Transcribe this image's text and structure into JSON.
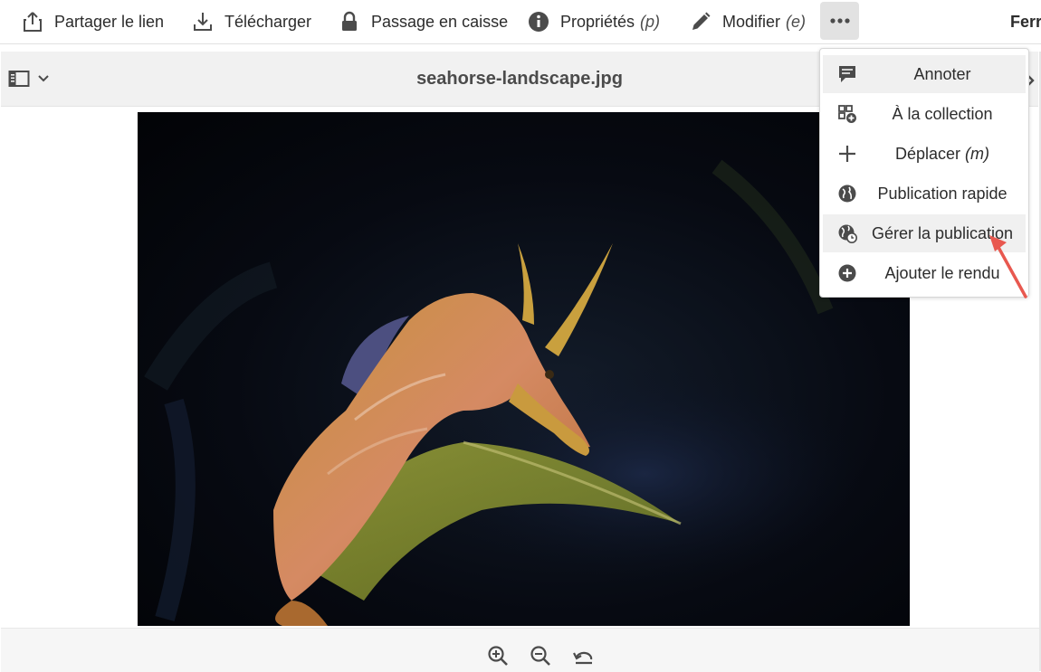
{
  "toolbar": {
    "share_label": "Partager le lien",
    "download_label": "Télécharger",
    "checkout_label": "Passage en caisse",
    "properties_label": "Propriétés",
    "properties_hotkey": "(p)",
    "edit_label": "Modifier",
    "edit_hotkey": "(e)",
    "more_label": "•••",
    "close_label": "Ferr"
  },
  "title_bar": {
    "file_name": "seahorse-landscape.jpg"
  },
  "menu": {
    "annotate_label": "Annoter",
    "to_collection_label": "À la collection",
    "move_label": "Déplacer",
    "move_hotkey": "(m)",
    "quick_publish_label": "Publication rapide",
    "manage_publication_label": "Gérer la publication",
    "add_rendition_label": "Ajouter le rendu"
  },
  "icons": {
    "share": "share-icon",
    "download": "download-icon",
    "checkout": "lock-icon",
    "properties": "info-icon",
    "edit": "pencil-icon",
    "more": "more-icon",
    "rail": "side-panel-icon",
    "annotate": "comment-icon",
    "collection": "collection-add-icon",
    "move": "move-icon",
    "quick_publish": "globe-icon",
    "manage_publication": "globe-clock-icon",
    "add_rendition": "add-circle-icon",
    "zoom_in": "zoom-in-icon",
    "zoom_out": "zoom-out-icon",
    "reset": "reset-zoom-icon"
  },
  "colors": {
    "annotation_arrow": "#e8584f",
    "menu_highlight": "#f0f0f0",
    "more_button_bg": "#e2e2e2"
  }
}
